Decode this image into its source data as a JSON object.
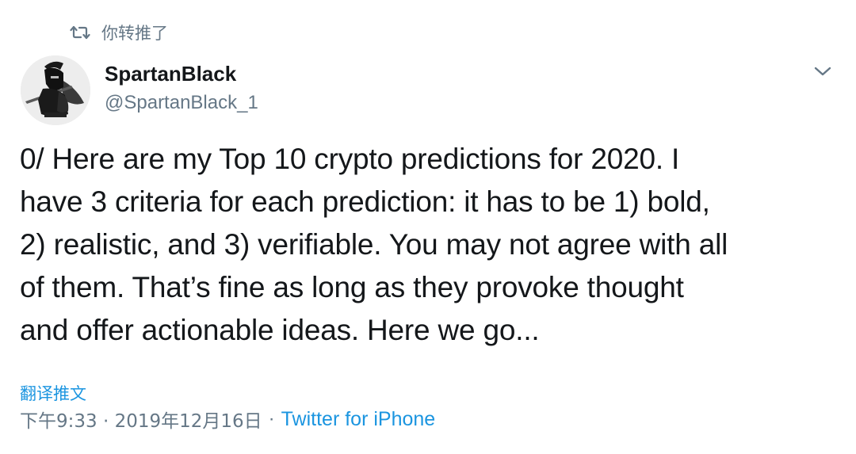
{
  "retweet": {
    "icon": "retweet-icon",
    "label": "你转推了"
  },
  "user": {
    "name": "SpartanBlack",
    "handle": "@SpartanBlack_1",
    "avatar": "spartan-warrior-avatar"
  },
  "menu": {
    "icon": "chevron-down-icon"
  },
  "tweet": {
    "lines": [
      "0/ Here are my Top 10 crypto predictions for 2020. I",
      "have 3 criteria for each prediction: it has to be 1) bold,",
      "2) realistic, and 3) verifiable. You may not agree with all",
      "of them. That’s fine as long as they provoke thought",
      "and offer actionable ideas. Here we go..."
    ]
  },
  "translate_label": "翻译推文",
  "meta": {
    "timestamp": "下午9:33 · 2019年12月16日",
    "separator": "·",
    "source": "Twitter for iPhone"
  },
  "colors": {
    "link": "#1b95e0",
    "secondary": "#657786",
    "text": "#14171a"
  }
}
